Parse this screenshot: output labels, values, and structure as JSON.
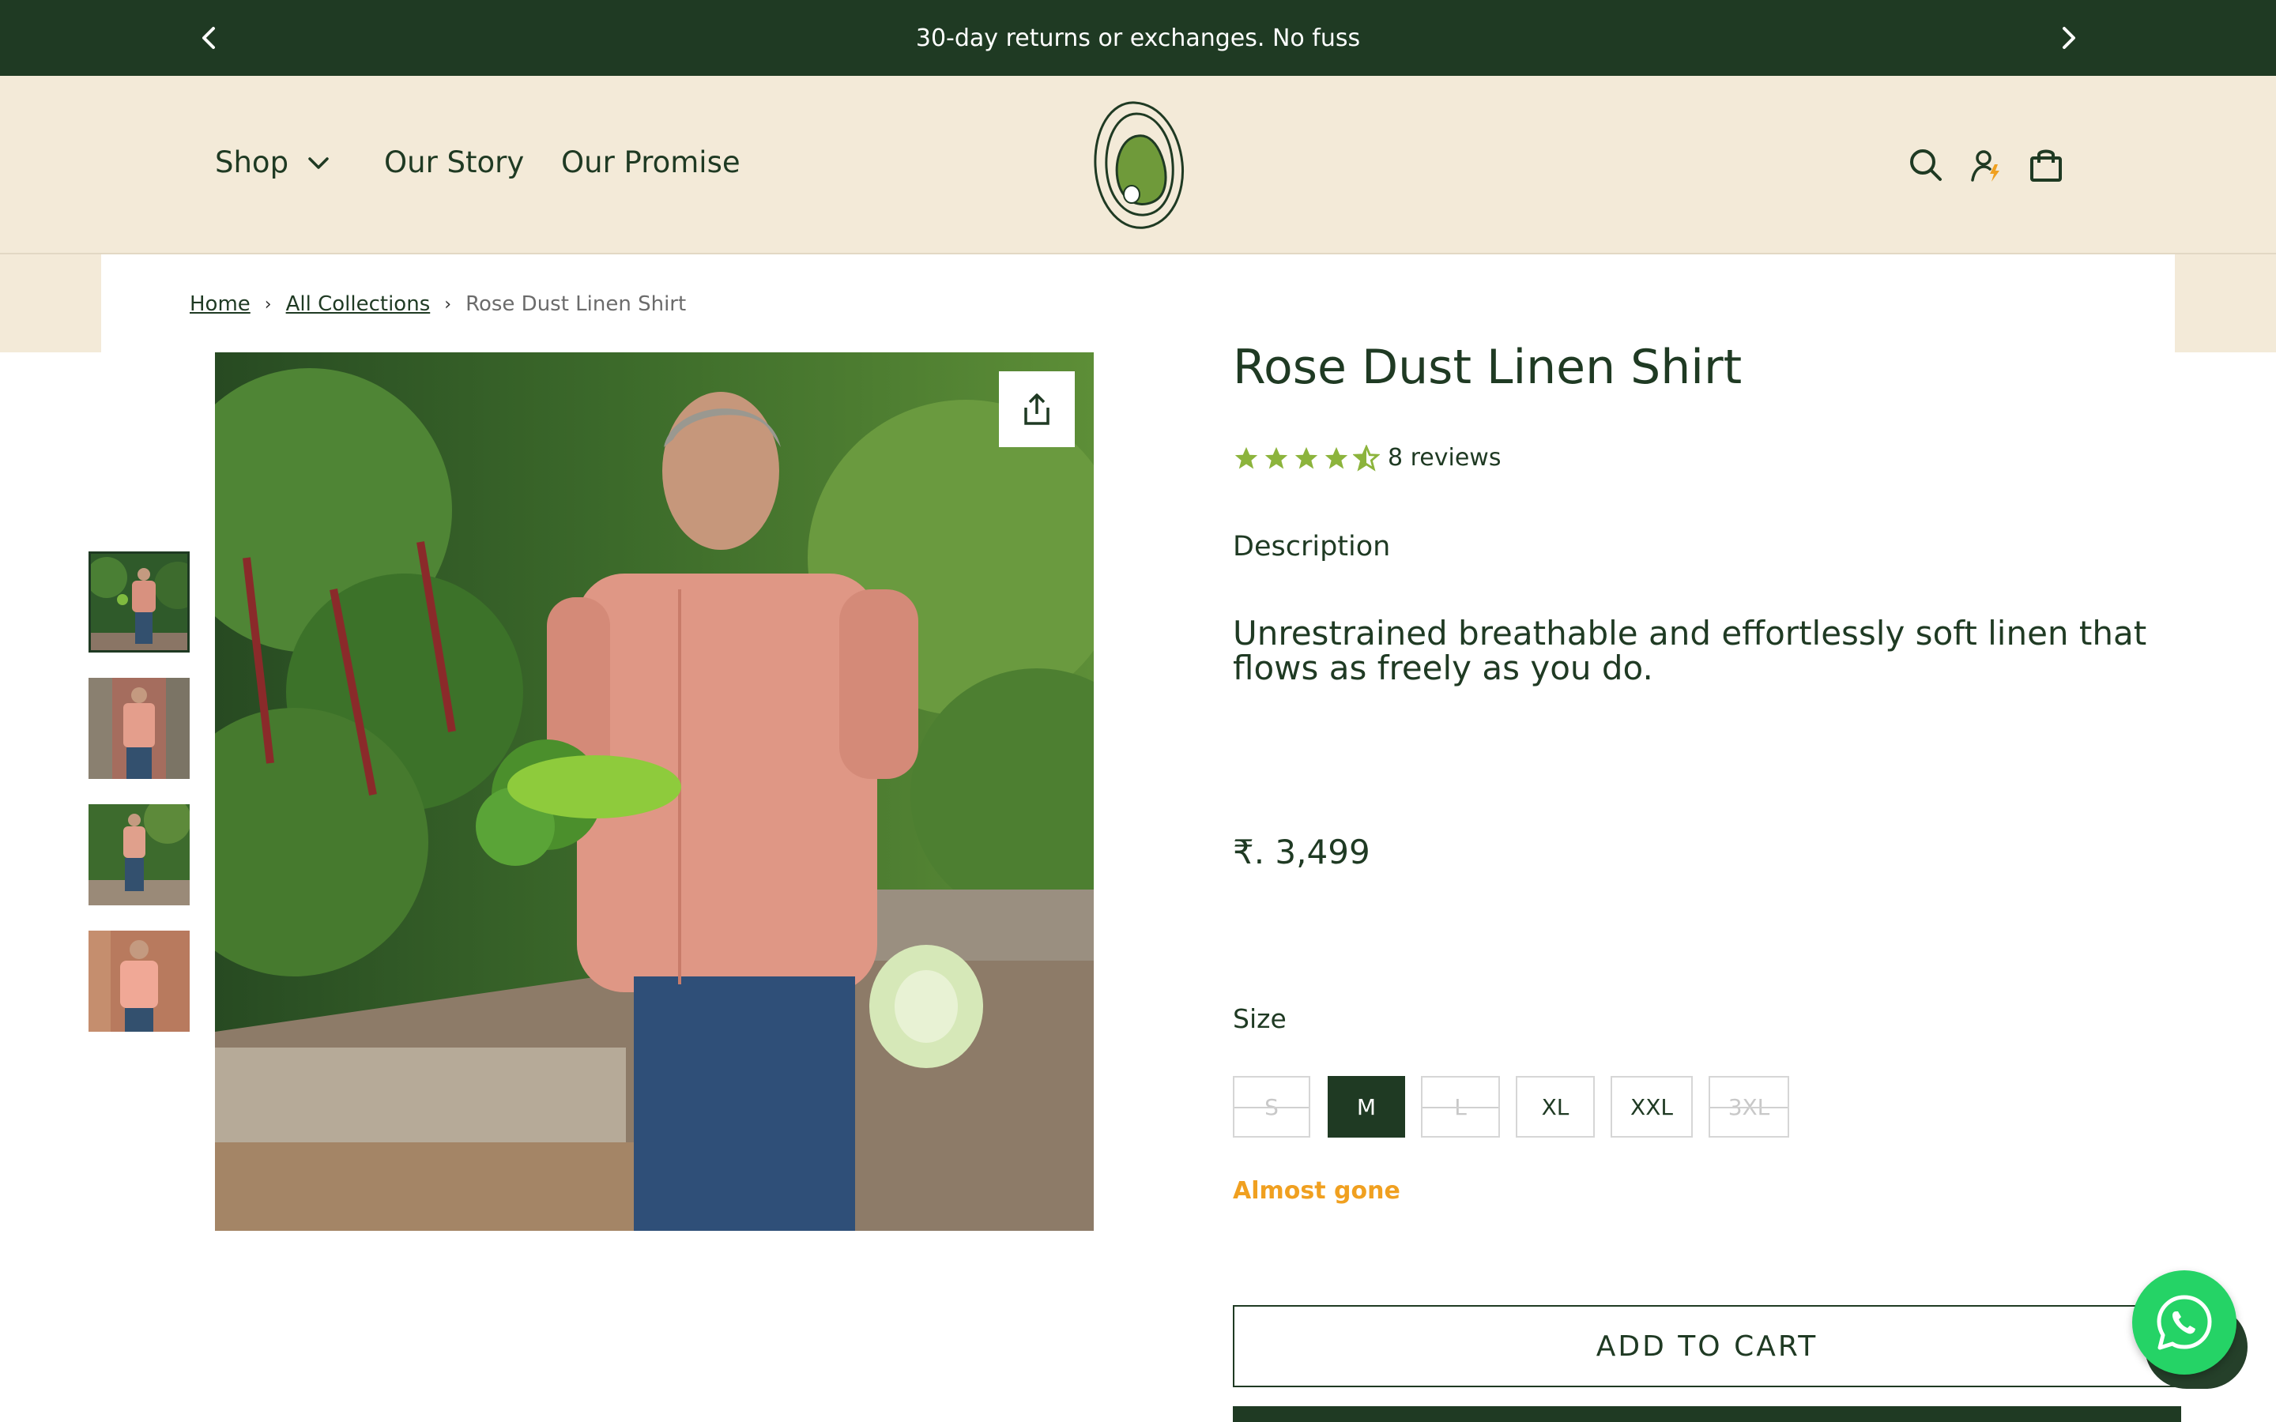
{
  "announcement": {
    "text": "30-day returns or exchanges. No fuss",
    "prev_icon": "chevron-left-icon",
    "next_icon": "chevron-right-icon"
  },
  "nav": {
    "shop": "Shop",
    "our_story": "Our Story",
    "our_promise": "Our Promise"
  },
  "header_icons": [
    "search-icon",
    "account-icon",
    "cart-bag-icon"
  ],
  "breadcrumb": {
    "home": "Home",
    "collections": "All Collections",
    "current": "Rose Dust Linen Shirt"
  },
  "product": {
    "title": "Rose Dust Linen Shirt",
    "rating": 4.5,
    "reviews": "8 reviews",
    "description_label": "Description",
    "description": "Unrestrained breathable and effortlessly soft linen that flows as freely as you do.",
    "price": "₹. 3,499",
    "size_label": "Size",
    "sizes": [
      {
        "label": "S",
        "available": false,
        "selected": false
      },
      {
        "label": "M",
        "available": true,
        "selected": true
      },
      {
        "label": "L",
        "available": false,
        "selected": false
      },
      {
        "label": "XL",
        "available": true,
        "selected": false
      },
      {
        "label": "XXL",
        "available": true,
        "selected": false
      },
      {
        "label": "3XL",
        "available": false,
        "selected": false
      }
    ],
    "stock_status": "Almost gone",
    "add_to_cart": "ADD TO CART"
  },
  "colors": {
    "brand_green": "#1f3a23",
    "header_bg": "#f3ead8",
    "star": "#8cb43c",
    "stock": "#f0a020",
    "whatsapp": "#25d366"
  }
}
